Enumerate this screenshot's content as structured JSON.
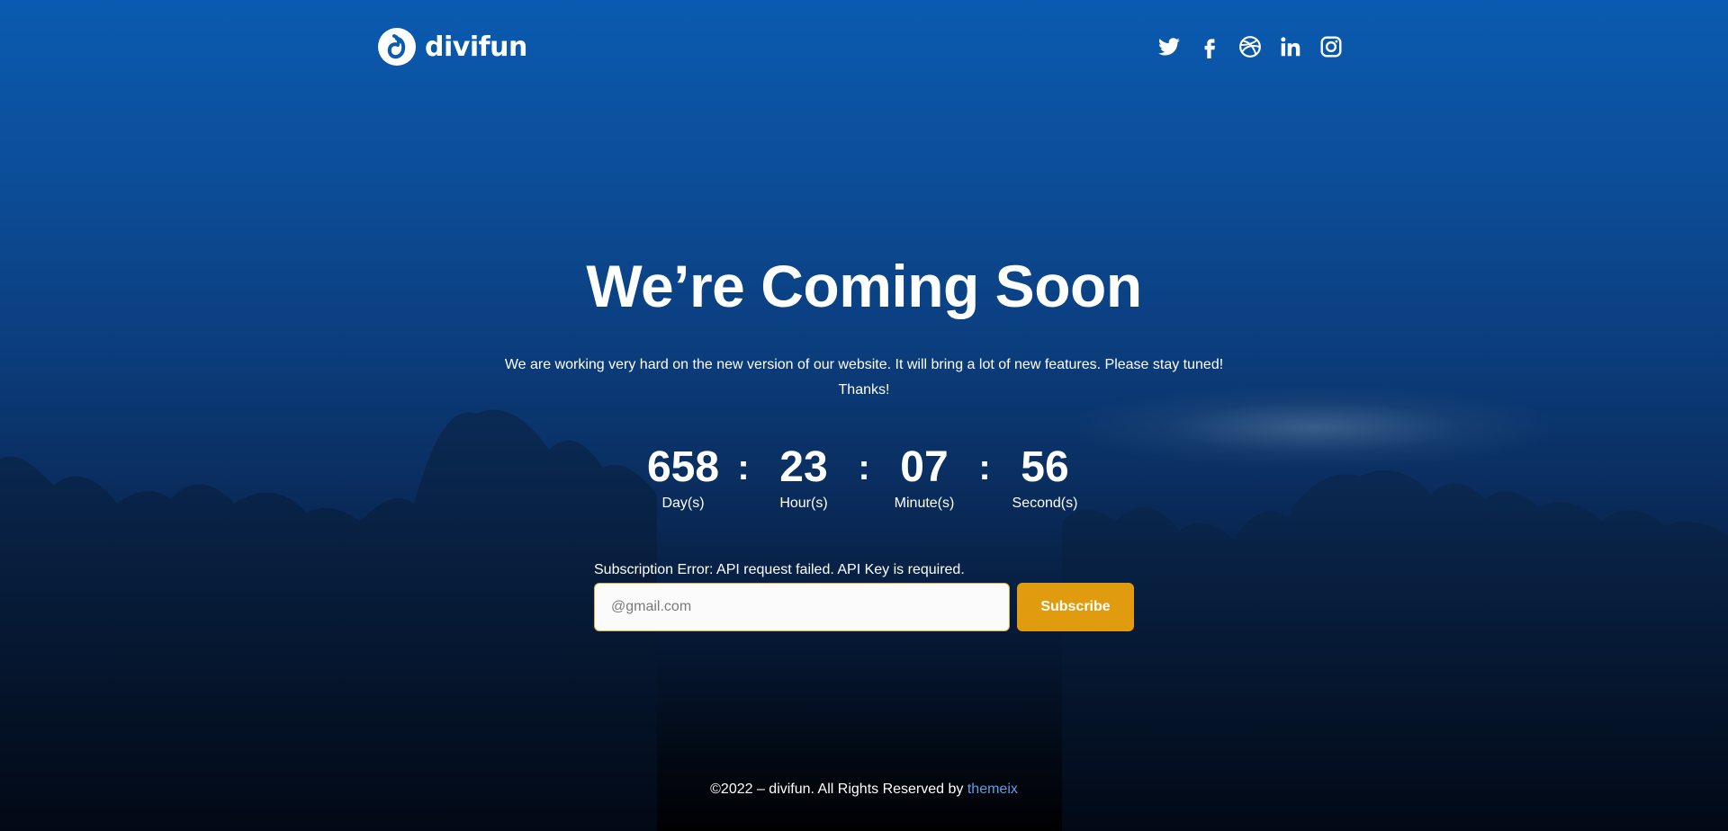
{
  "brand": {
    "name": "divifun",
    "logo_icon": "divifun-logo-icon"
  },
  "social": [
    {
      "name": "twitter-icon"
    },
    {
      "name": "facebook-icon"
    },
    {
      "name": "dribbble-icon"
    },
    {
      "name": "linkedin-icon"
    },
    {
      "name": "instagram-icon"
    }
  ],
  "hero": {
    "title": "We’re Coming Soon",
    "text": "We are working very hard on the new version of our website. It will bring a  lot of new features. Please stay tuned! Thanks!"
  },
  "countdown": {
    "days": "658",
    "days_label": "Day(s)",
    "hours": "23",
    "hours_label": "Hour(s)",
    "minutes": "07",
    "minutes_label": "Minute(s)",
    "seconds": "56",
    "seconds_label": "Second(s)",
    "separator": ":"
  },
  "subscribe": {
    "error": "Subscription Error: API request failed. API Key is required.",
    "placeholder": "@gmail.com",
    "button_label": "Subscribe",
    "button_color": "#e09b0e"
  },
  "footer": {
    "text": "©2022 – divifun. All Rights Reserved by ",
    "link_label": "themeix",
    "link_color": "#5aa0e8"
  }
}
